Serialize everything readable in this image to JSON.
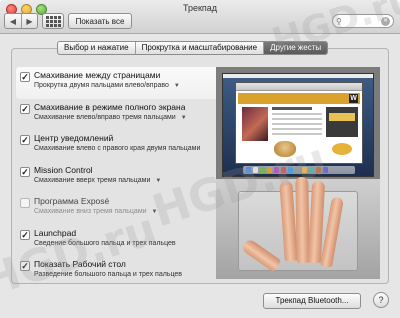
{
  "window": {
    "title": "Трекпад"
  },
  "toolbar": {
    "show_all_label": "Показать все",
    "back_glyph": "◀",
    "forward_glyph": "▶"
  },
  "tabs": [
    {
      "label": "Выбор и нажатие",
      "active": false
    },
    {
      "label": "Прокрутка и масштабирование",
      "active": false
    },
    {
      "label": "Другие жесты",
      "active": true
    }
  ],
  "options": [
    {
      "title": "Смахивание между страницами",
      "subtitle": "Прокрутка двумя пальцами влево/вправо",
      "checked": true,
      "selected": true,
      "has_menu": true
    },
    {
      "title": "Смахивание в режиме полного экрана",
      "subtitle": "Смахивание влево/вправо тремя пальцами",
      "checked": true,
      "selected": false,
      "has_menu": true
    },
    {
      "title": "Центр уведомлений",
      "subtitle": "Смахивание влево с правого края двумя пальцами",
      "checked": true,
      "selected": false,
      "has_menu": false
    },
    {
      "title": "Mission Control",
      "subtitle": "Смахивание вверх тремя пальцами",
      "checked": true,
      "selected": false,
      "has_menu": true
    },
    {
      "title": "Программа Exposé",
      "subtitle": "Смахивание вниз тремя пальцами",
      "checked": false,
      "selected": false,
      "has_menu": true
    },
    {
      "title": "Launchpad",
      "subtitle": "Сведение большого пальца и трех пальцев",
      "checked": true,
      "selected": false,
      "has_menu": false
    },
    {
      "title": "Показать Рабочий стол",
      "subtitle": "Разведение большого пальца и трех пальцев",
      "checked": true,
      "selected": false,
      "has_menu": false
    }
  ],
  "preview": {
    "page_logo": "W"
  },
  "footer": {
    "bluetooth_label": "Трекпад Bluetooth...",
    "help_label": "?"
  },
  "watermark": {
    "text": "HGD.ru"
  },
  "colors": {
    "active_tab": "#5f5f5f",
    "preview_banner": "#d9a22c"
  }
}
